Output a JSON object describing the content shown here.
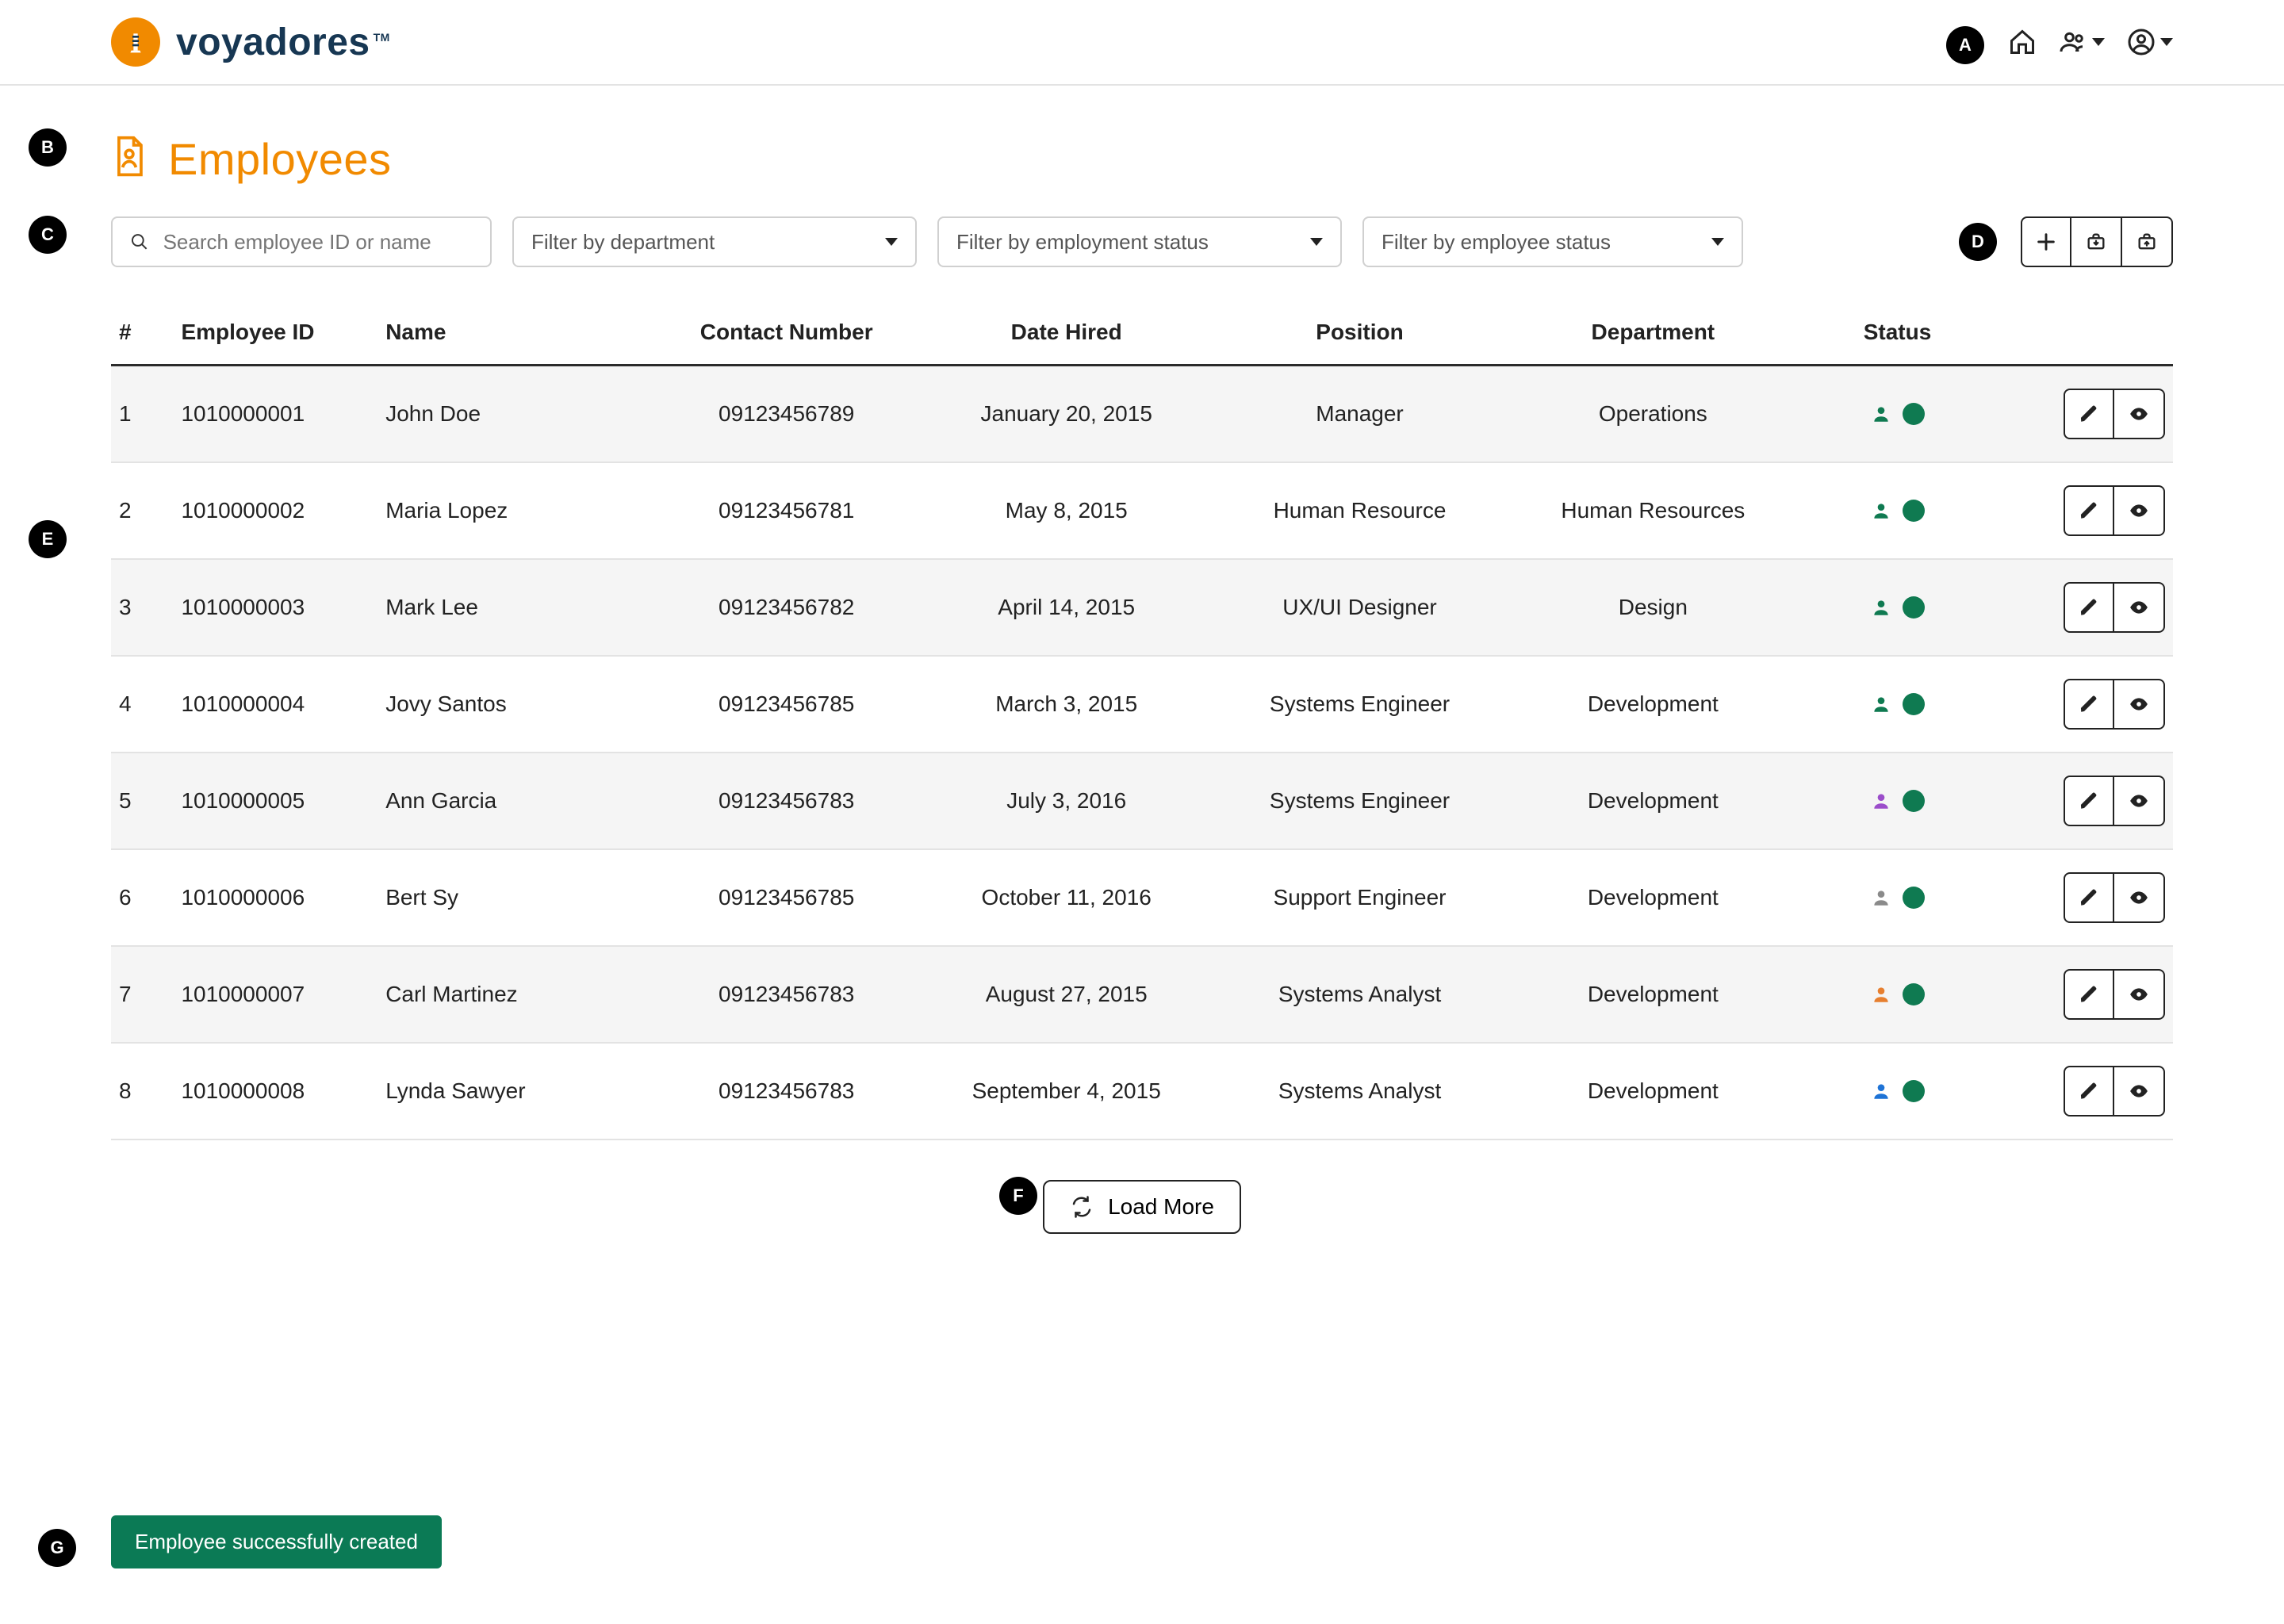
{
  "brand": {
    "name": "voyadores",
    "trademark": "TM"
  },
  "annotations": {
    "a": "A",
    "b": "B",
    "c": "C",
    "d": "D",
    "e": "E",
    "f": "F",
    "g": "G"
  },
  "heading": {
    "title": "Employees"
  },
  "filters": {
    "search_placeholder": "Search employee ID or name",
    "department_placeholder": "Filter by department",
    "employment_status_placeholder": "Filter by employment status",
    "employee_status_placeholder": "Filter by employee status"
  },
  "table": {
    "headers": {
      "num": "#",
      "id": "Employee ID",
      "name": "Name",
      "contact": "Contact Number",
      "date": "Date Hired",
      "position": "Position",
      "department": "Department",
      "status": "Status"
    },
    "rows": [
      {
        "num": "1",
        "id": "1010000001",
        "name": "John Doe",
        "contact": "09123456789",
        "date": "January 20, 2015",
        "position": "Manager",
        "department": "Operations",
        "person_color": "#0f7a51"
      },
      {
        "num": "2",
        "id": "1010000002",
        "name": "Maria Lopez",
        "contact": "09123456781",
        "date": "May 8, 2015",
        "position": "Human Resource",
        "department": "Human Resources",
        "person_color": "#0f7a51"
      },
      {
        "num": "3",
        "id": "1010000003",
        "name": "Mark Lee",
        "contact": "09123456782",
        "date": "April 14, 2015",
        "position": "UX/UI Designer",
        "department": "Design",
        "person_color": "#0f7a51"
      },
      {
        "num": "4",
        "id": "1010000004",
        "name": "Jovy Santos",
        "contact": "09123456785",
        "date": "March 3, 2015",
        "position": "Systems Engineer",
        "department": "Development",
        "person_color": "#0f7a51"
      },
      {
        "num": "5",
        "id": "1010000005",
        "name": "Ann Garcia",
        "contact": "09123456783",
        "date": "July 3, 2016",
        "position": "Systems Engineer",
        "department": "Development",
        "person_color": "#9b4dca"
      },
      {
        "num": "6",
        "id": "1010000006",
        "name": "Bert Sy",
        "contact": "09123456785",
        "date": "October 11, 2016",
        "position": "Support Engineer",
        "department": "Development",
        "person_color": "#8a8a8a"
      },
      {
        "num": "7",
        "id": "1010000007",
        "name": "Carl Martinez",
        "contact": "09123456783",
        "date": "August 27, 2015",
        "position": "Systems Analyst",
        "department": "Development",
        "person_color": "#e77f2f"
      },
      {
        "num": "8",
        "id": "1010000008",
        "name": "Lynda Sawyer",
        "contact": "09123456783",
        "date": "September 4, 2015",
        "position": "Systems Analyst",
        "department": "Development",
        "person_color": "#1e73d6"
      }
    ]
  },
  "load_more_label": "Load More",
  "toast": {
    "message": "Employee successfully created"
  }
}
